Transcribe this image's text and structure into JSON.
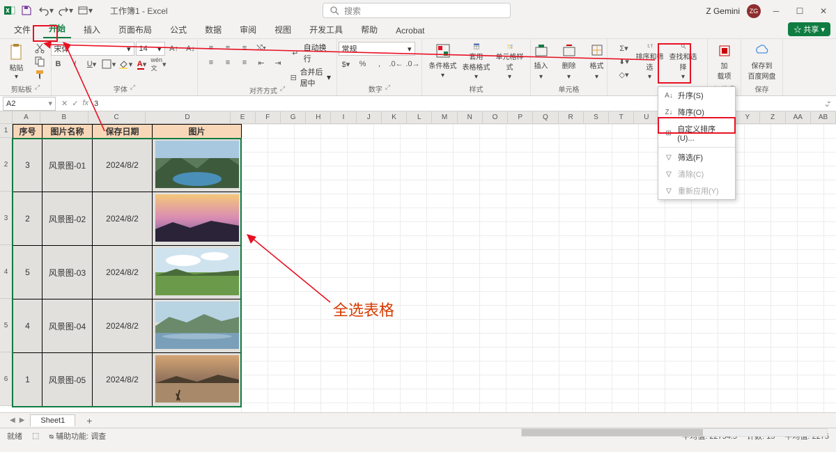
{
  "titlebar": {
    "doc_title": "工作簿1 - Excel",
    "search_placeholder": "搜索",
    "user_name": "Z Gemini",
    "user_initials": "ZG"
  },
  "menubar": {
    "tabs": [
      "文件",
      "开始",
      "插入",
      "页面布局",
      "公式",
      "数据",
      "审阅",
      "视图",
      "开发工具",
      "帮助",
      "Acrobat"
    ],
    "active": "开始",
    "share": "共享"
  },
  "ribbon": {
    "clipboard": {
      "label": "剪贴板",
      "paste": "粘贴"
    },
    "font": {
      "label": "字体",
      "name": "宋体",
      "size": "14"
    },
    "align": {
      "label": "对齐方式",
      "wrap": "自动换行",
      "merge": "合并后居中"
    },
    "number": {
      "label": "数字",
      "format": "常规"
    },
    "styles": {
      "label": "样式",
      "cond": "条件格式",
      "as_table": "套用\n表格格式",
      "cell_styles": "单元格样式"
    },
    "cells": {
      "label": "单元格",
      "insert": "插入",
      "delete": "删除",
      "format": "格式"
    },
    "editing": {
      "sort_filter": "排序和筛选",
      "find_select": "查找和选择"
    },
    "addins": {
      "label": "加载项",
      "addin": "加\n载项"
    },
    "save": {
      "label": "保存",
      "baidu": "保存到\n百度网盘"
    }
  },
  "sort_menu": {
    "asc": "升序(S)",
    "desc": "降序(O)",
    "custom": "自定义排序(U)...",
    "filter": "筛选(F)",
    "clear": "清除(C)",
    "reapply": "重新应用(Y)"
  },
  "formula_bar": {
    "cell_ref": "A2",
    "fx": "fx",
    "value": "3"
  },
  "columns": [
    "A",
    "B",
    "C",
    "D",
    "E",
    "F",
    "G",
    "H",
    "I",
    "J",
    "K",
    "L",
    "M",
    "N",
    "O",
    "P",
    "Q",
    "R",
    "S",
    "T",
    "U",
    "V",
    "W",
    "X",
    "Y",
    "Z",
    "AA",
    "AB"
  ],
  "table": {
    "headers": [
      "序号",
      "图片名称",
      "保存日期",
      "图片"
    ],
    "rows": [
      {
        "num": "3",
        "name": "风景图-01",
        "date": "2024/8/2"
      },
      {
        "num": "2",
        "name": "风景图-02",
        "date": "2024/8/2"
      },
      {
        "num": "5",
        "name": "风景图-03",
        "date": "2024/8/2"
      },
      {
        "num": "4",
        "name": "风景图-04",
        "date": "2024/8/2"
      },
      {
        "num": "1",
        "name": "风景图-05",
        "date": "2024/8/2"
      }
    ]
  },
  "sheet_tab": "Sheet1",
  "annotation_text": "全选表格",
  "statusbar": {
    "ready": "就绪",
    "access": "辅助功能: 调查",
    "avg": "平均值: 22754.5",
    "count": "计数: 15",
    "avg2": "平均值: 2275"
  }
}
